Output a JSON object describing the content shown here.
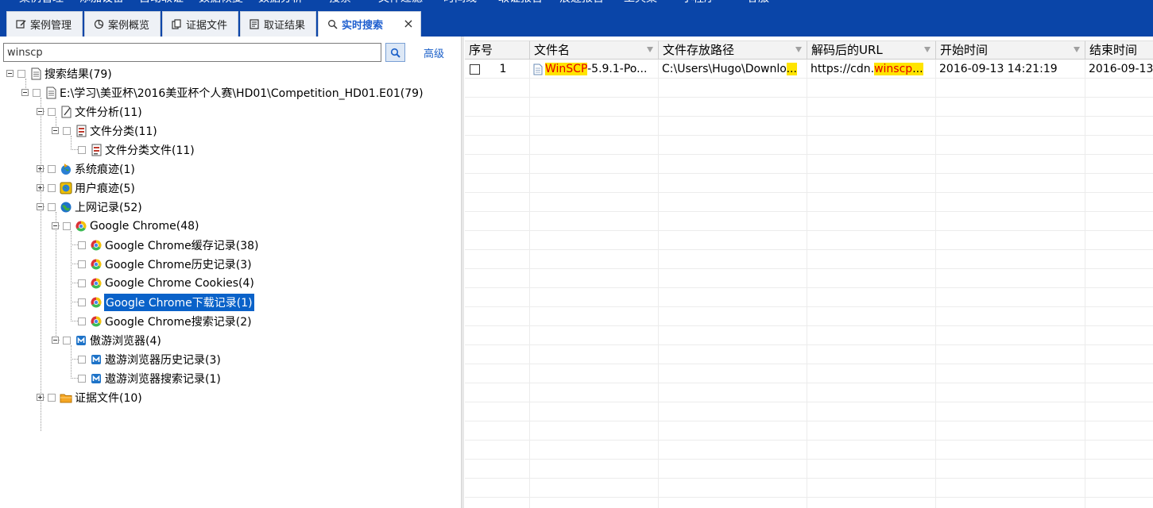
{
  "menu": [
    "案例管理",
    "添加设备",
    "自动取证",
    "数据恢复",
    "数据分析",
    "搜索",
    "文件过滤",
    "时间线",
    "取证报告",
    "痕迹报告",
    "工具集",
    "小程序",
    "客服"
  ],
  "tabs": [
    {
      "label": "案例管理",
      "icon": "edit-icon"
    },
    {
      "label": "案例概览",
      "icon": "pie-chart-icon"
    },
    {
      "label": "证据文件",
      "icon": "copy-icon"
    },
    {
      "label": "取证结果",
      "icon": "list-icon"
    },
    {
      "label": "实时搜索",
      "icon": "search-icon",
      "active": true
    }
  ],
  "search": {
    "value": "winscp",
    "advanced_label": "高级"
  },
  "tree": [
    {
      "label": "搜索结果(79)",
      "icon": "document-icon",
      "depth": 0
    },
    {
      "label": "E:\\学习\\美亚杯\\2016美亚杯个人赛\\HD01\\Competition_HD01.E01(79)",
      "icon": "disk-image-icon",
      "depth": 1
    },
    {
      "label": "文件分析(11)",
      "icon": "file-analysis-icon",
      "depth": 2
    },
    {
      "label": "文件分类(11)",
      "icon": "category-icon",
      "depth": 3
    },
    {
      "label": "文件分类文件(11)",
      "icon": "category-icon",
      "depth": 4
    },
    {
      "label": "系统痕迹(1)",
      "icon": "system-globe-icon",
      "depth": 2
    },
    {
      "label": "用户痕迹(5)",
      "icon": "user-trace-icon",
      "depth": 2
    },
    {
      "label": "上网记录(52)",
      "icon": "internet-globe-icon",
      "depth": 2
    },
    {
      "label": "Google Chrome(48)",
      "icon": "chrome-icon",
      "depth": 3
    },
    {
      "label": "Google Chrome缓存记录(38)",
      "icon": "chrome-icon",
      "depth": 4
    },
    {
      "label": "Google Chrome历史记录(3)",
      "icon": "chrome-icon",
      "depth": 4
    },
    {
      "label": "Google Chrome Cookies(4)",
      "icon": "chrome-icon",
      "depth": 4
    },
    {
      "label": "Google Chrome下载记录(1)",
      "icon": "chrome-icon",
      "depth": 4,
      "selected": true
    },
    {
      "label": "Google Chrome搜索记录(2)",
      "icon": "chrome-icon",
      "depth": 4
    },
    {
      "label": "傲游浏览器(4)",
      "icon": "maxthon-icon",
      "depth": 3
    },
    {
      "label": "遨游浏览器历史记录(3)",
      "icon": "maxthon-icon",
      "depth": 4
    },
    {
      "label": "遨游浏览器搜索记录(1)",
      "icon": "maxthon-icon",
      "depth": 4
    },
    {
      "label": "证据文件(10)",
      "icon": "folder-icon",
      "depth": 2
    }
  ],
  "table": {
    "columns": [
      "序号",
      "文件名",
      "文件存放路径",
      "解码后的URL",
      "开始时间",
      "结束时间"
    ],
    "rows": [
      {
        "index": "1",
        "filename_hl": "WinSCP",
        "filename_rest": "-5.9.1-Po...",
        "path": "C:\\Users\\Hugo\\Downlo",
        "path_hl": "...",
        "url_pre": "https://cdn.",
        "url_hl": "winscp",
        "url_post": "...",
        "start": "2016-09-13 14:21:19",
        "end": "2016-09-13"
      }
    ]
  }
}
